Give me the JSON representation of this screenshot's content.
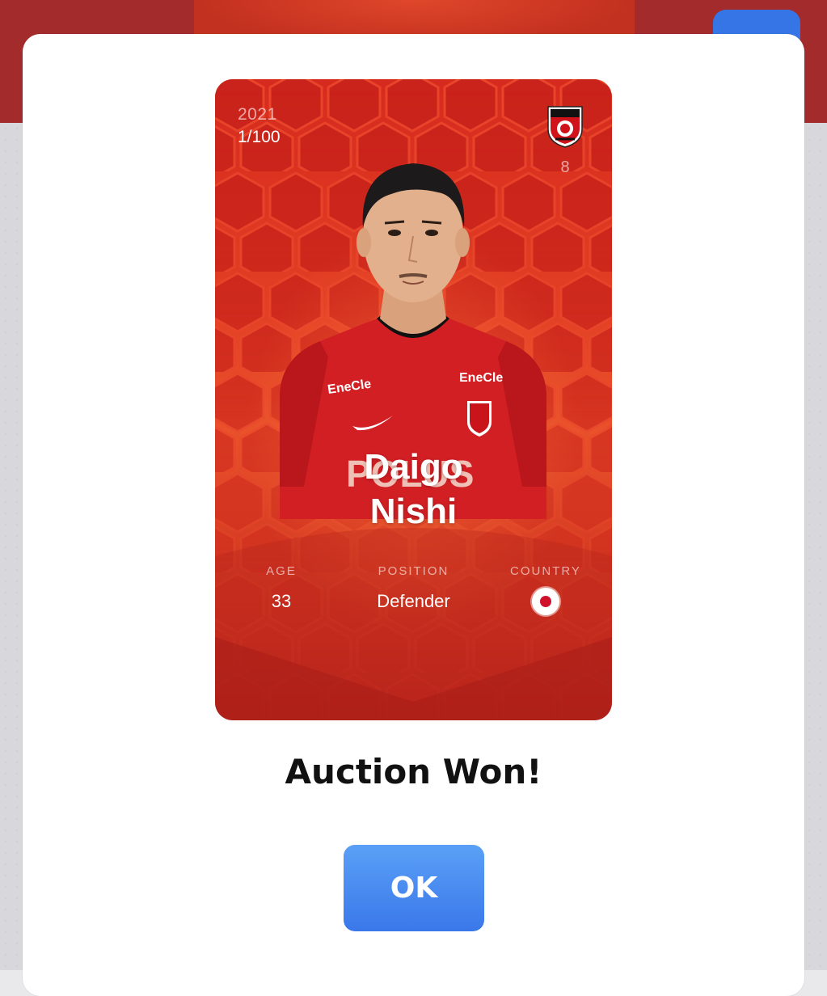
{
  "colors": {
    "accent": "#3a78ea",
    "card_red": "#d62a1e",
    "header_red": "#a32b2b"
  },
  "card": {
    "season": "2021",
    "serial": "1/100",
    "shirt_number": "8",
    "club_logo_icon": "urawa-reds-crest-icon",
    "player_first": "Daigo",
    "player_last": "Nishi",
    "stats": {
      "age_label": "AGE",
      "age_value": "33",
      "position_label": "POSITION",
      "position_value": "Defender",
      "country_label": "COUNTRY",
      "country_flag_icon": "japan-flag-icon"
    }
  },
  "dialog": {
    "title": "Auction Won!",
    "ok_label": "OK"
  }
}
